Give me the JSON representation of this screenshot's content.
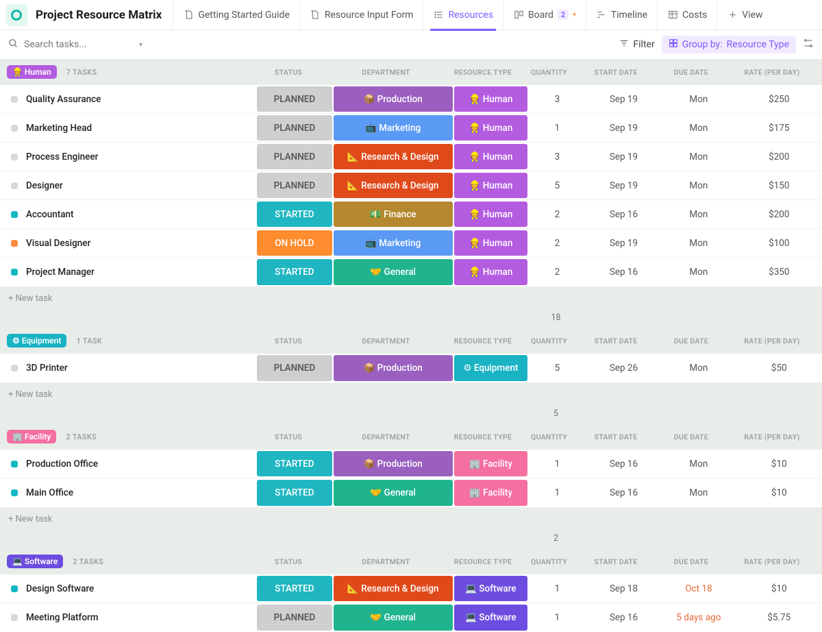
{
  "header": {
    "title": "Project Resource Matrix",
    "tabs": [
      {
        "icon": "doc-pin",
        "label": "Getting Started Guide"
      },
      {
        "icon": "doc-pin",
        "label": "Resource Input Form"
      },
      {
        "icon": "list",
        "label": "Resources",
        "active": true
      },
      {
        "icon": "board",
        "label": "Board",
        "badge": "2",
        "caret": true
      },
      {
        "icon": "gantt",
        "label": "Timeline"
      },
      {
        "icon": "table",
        "label": "Costs"
      },
      {
        "icon": "plus",
        "label": "View"
      }
    ]
  },
  "toolbar": {
    "search_placeholder": "Search tasks...",
    "filter_label": "Filter",
    "groupby_label": "Group by:",
    "groupby_value": "Resource Type"
  },
  "columns": {
    "status": "STATUS",
    "department": "DEPARTMENT",
    "rtype": "RESOURCE TYPE",
    "qty": "QUANTITY",
    "sdate": "START DATE",
    "ddate": "DUE DATE",
    "rate": "RATE (PER DAY)"
  },
  "strings": {
    "new_task": "+ New task"
  },
  "groups": [
    {
      "pill_class": "gp-human",
      "pill_icon": "👷",
      "pill_label": "Human",
      "count_label": "7 TASKS",
      "sum_qty": "18",
      "rows": [
        {
          "dot": "gray",
          "name": "Quality Assurance",
          "status": "PLANNED",
          "status_cls": "status-planned",
          "dept": "📦 Production",
          "dept_cls": "dept-production",
          "rtype": "👷 Human",
          "rtype_cls": "rtype-human",
          "qty": "3",
          "sdate": "Sep 19",
          "ddate": "Mon",
          "rate": "$250"
        },
        {
          "dot": "gray",
          "name": "Marketing Head",
          "status": "PLANNED",
          "status_cls": "status-planned",
          "dept": "📺 Marketing",
          "dept_cls": "dept-marketing",
          "rtype": "👷 Human",
          "rtype_cls": "rtype-human",
          "qty": "1",
          "sdate": "Sep 19",
          "ddate": "Mon",
          "rate": "$175"
        },
        {
          "dot": "gray",
          "name": "Process Engineer",
          "status": "PLANNED",
          "status_cls": "status-planned",
          "dept": "📐 Research & Design",
          "dept_cls": "dept-research",
          "rtype": "👷 Human",
          "rtype_cls": "rtype-human",
          "qty": "3",
          "sdate": "Sep 19",
          "ddate": "Mon",
          "rate": "$200"
        },
        {
          "dot": "gray",
          "name": "Designer",
          "status": "PLANNED",
          "status_cls": "status-planned",
          "dept": "📐 Research & Design",
          "dept_cls": "dept-research",
          "rtype": "👷 Human",
          "rtype_cls": "rtype-human",
          "qty": "5",
          "sdate": "Sep 19",
          "ddate": "Mon",
          "rate": "$150"
        },
        {
          "dot": "teal",
          "name": "Accountant",
          "status": "STARTED",
          "status_cls": "status-started",
          "dept": "💵 Finance",
          "dept_cls": "dept-finance",
          "rtype": "👷 Human",
          "rtype_cls": "rtype-human",
          "qty": "2",
          "sdate": "Sep 16",
          "ddate": "Mon",
          "rate": "$200"
        },
        {
          "dot": "orange",
          "name": "Visual Designer",
          "status": "ON HOLD",
          "status_cls": "status-onhold",
          "dept": "📺 Marketing",
          "dept_cls": "dept-marketing",
          "rtype": "👷 Human",
          "rtype_cls": "rtype-human",
          "qty": "2",
          "sdate": "Sep 19",
          "ddate": "Mon",
          "rate": "$100"
        },
        {
          "dot": "teal",
          "name": "Project Manager",
          "status": "STARTED",
          "status_cls": "status-started",
          "dept": "🤝 General",
          "dept_cls": "dept-general",
          "rtype": "👷 Human",
          "rtype_cls": "rtype-human",
          "qty": "2",
          "sdate": "Sep 16",
          "ddate": "Mon",
          "rate": "$350"
        }
      ]
    },
    {
      "pill_class": "gp-equip",
      "pill_icon": "⚙",
      "pill_label": "Equipment",
      "count_label": "1 TASK",
      "sum_qty": "5",
      "rows": [
        {
          "dot": "gray",
          "name": "3D Printer",
          "status": "PLANNED",
          "status_cls": "status-planned",
          "dept": "📦 Production",
          "dept_cls": "dept-production",
          "rtype": "⚙ Equipment",
          "rtype_cls": "rtype-equip",
          "qty": "5",
          "sdate": "Sep 26",
          "ddate": "Mon",
          "rate": "$50"
        }
      ]
    },
    {
      "pill_class": "gp-facility",
      "pill_icon": "🏢",
      "pill_label": "Facility",
      "count_label": "2 TASKS",
      "sum_qty": "2",
      "rows": [
        {
          "dot": "teal",
          "name": "Production Office",
          "status": "STARTED",
          "status_cls": "status-started",
          "dept": "📦 Production",
          "dept_cls": "dept-production",
          "rtype": "🏢 Facility",
          "rtype_cls": "rtype-facility",
          "qty": "1",
          "sdate": "Sep 16",
          "ddate": "Mon",
          "rate": "$10"
        },
        {
          "dot": "teal",
          "name": "Main Office",
          "status": "STARTED",
          "status_cls": "status-started",
          "dept": "🤝 General",
          "dept_cls": "dept-general",
          "rtype": "🏢 Facility",
          "rtype_cls": "rtype-facility",
          "qty": "1",
          "sdate": "Sep 16",
          "ddate": "Mon",
          "rate": "$10"
        }
      ]
    },
    {
      "pill_class": "gp-software",
      "pill_icon": "💻",
      "pill_label": "Software",
      "count_label": "2 TASKS",
      "no_footer": true,
      "rows": [
        {
          "dot": "teal",
          "name": "Design Software",
          "status": "STARTED",
          "status_cls": "status-started",
          "dept": "📐 Research & Design",
          "dept_cls": "dept-research",
          "rtype": "💻 Software",
          "rtype_cls": "rtype-software",
          "qty": "1",
          "sdate": "Sep 18",
          "ddate": "Oct 18",
          "ddate_warn": true,
          "rate": "$10"
        },
        {
          "dot": "gray",
          "name": "Meeting Platform",
          "status": "PLANNED",
          "status_cls": "status-planned",
          "dept": "🤝 General",
          "dept_cls": "dept-general",
          "rtype": "💻 Software",
          "rtype_cls": "rtype-software",
          "qty": "1",
          "sdate": "Sep 16",
          "ddate": "5 days ago",
          "ddate_warn": true,
          "rate": "$5.75"
        }
      ]
    }
  ]
}
